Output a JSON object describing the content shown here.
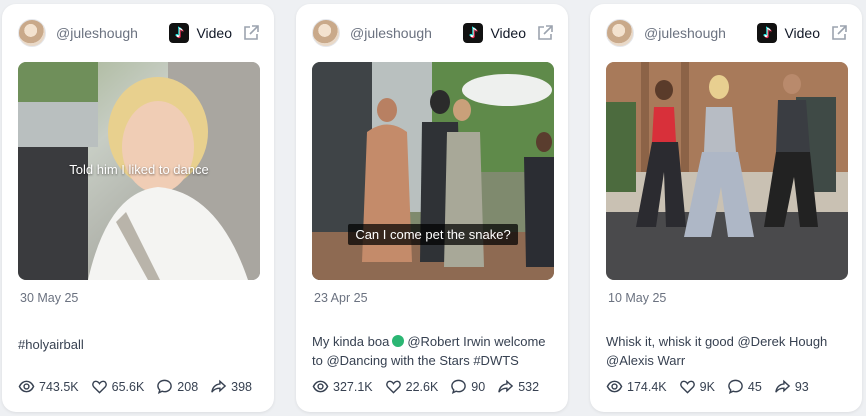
{
  "posts": [
    {
      "handle": "@juleshough",
      "platform_label": "Video",
      "overlay_text": "Told him I liked to dance",
      "date": "30 May 25",
      "description": "#holyairball",
      "stats": {
        "views": "743.5K",
        "likes": "65.6K",
        "comments": "208",
        "shares": "398"
      }
    },
    {
      "handle": "@juleshough",
      "platform_label": "Video",
      "overlay_text": "Can I come pet the snake?",
      "date": "23 Apr 25",
      "description_before_emoji": "My kinda boa",
      "description_after_emoji": "@Robert Irwin welcome to @Dancing with the Stars #DWTS",
      "stats": {
        "views": "327.1K",
        "likes": "22.6K",
        "comments": "90",
        "shares": "532"
      }
    },
    {
      "handle": "@juleshough",
      "platform_label": "Video",
      "date": "10 May 25",
      "description": "Whisk it, whisk it good @Derek Hough @Alexis Warr",
      "stats": {
        "views": "174.4K",
        "likes": "9K",
        "comments": "45",
        "shares": "93"
      }
    }
  ],
  "icons": {
    "platform": "tiktok-icon",
    "external": "external-link-icon",
    "views": "eye-icon",
    "likes": "heart-icon",
    "comments": "comment-icon",
    "shares": "share-icon",
    "emoji": "snake-emoji-icon"
  },
  "colors": {
    "background": "#eef0f3",
    "card": "#ffffff",
    "muted_text": "#6b7280",
    "tiktok_cyan": "#25f4ee",
    "tiktok_red": "#fe2c55"
  }
}
